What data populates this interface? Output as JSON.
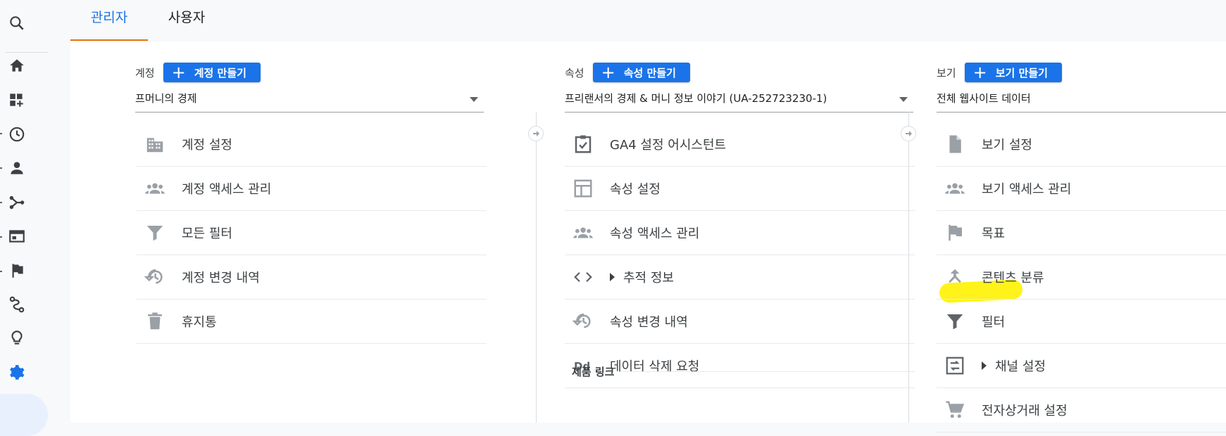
{
  "tabs": [
    {
      "label": "관리자",
      "active": true
    },
    {
      "label": "사용자",
      "active": false
    }
  ],
  "rail": {
    "icons": [
      "search-icon",
      "home-icon",
      "dashboard-add-icon",
      "clock-icon",
      "person-icon",
      "share-icon",
      "view-icon",
      "flag-icon",
      "route-icon",
      "lightbulb-icon",
      "gear-icon"
    ]
  },
  "account": {
    "label": "계정",
    "create_button": "계정 만들기",
    "selected": "프머니의 경제",
    "items": [
      {
        "label": "계정 설정",
        "icon": "building-icon"
      },
      {
        "label": "계정 액세스 관리",
        "icon": "people-icon"
      },
      {
        "label": "모든 필터",
        "icon": "filter-icon"
      },
      {
        "label": "계정 변경 내역",
        "icon": "history-icon"
      },
      {
        "label": "휴지통",
        "icon": "trash-icon"
      }
    ]
  },
  "property": {
    "label": "속성",
    "create_button": "속성 만들기",
    "selected": "프리랜서의 경제 & 머니 정보 이야기 (UA-252723230-1)",
    "items": [
      {
        "label": "GA4 설정 어시스턴트",
        "icon": "checklist-icon"
      },
      {
        "label": "속성 설정",
        "icon": "layout-icon"
      },
      {
        "label": "속성 액세스 관리",
        "icon": "people-icon"
      },
      {
        "label": "추적 정보",
        "icon": "code-icon",
        "expandable": true
      },
      {
        "label": "속성 변경 내역",
        "icon": "history-icon"
      },
      {
        "label": "데이터 삭제 요청",
        "icon": "dd-icon"
      }
    ],
    "section": "제품 링크"
  },
  "view": {
    "label": "보기",
    "create_button": "보기 만들기",
    "selected": "전체 웹사이트 데이터",
    "items": [
      {
        "label": "보기 설정",
        "icon": "document-icon"
      },
      {
        "label": "보기 액세스 관리",
        "icon": "people-icon"
      },
      {
        "label": "목표",
        "icon": "flag-icon"
      },
      {
        "label": "콘텐츠 분류",
        "icon": "merge-icon"
      },
      {
        "label": "필터",
        "icon": "filter-icon",
        "highlighted": true
      },
      {
        "label": "채널 설정",
        "icon": "channel-icon",
        "expandable": true
      },
      {
        "label": "전자상거래 설정",
        "icon": "cart-icon"
      }
    ]
  },
  "colors": {
    "accent": "#1a73e8",
    "tab_underline": "#e8710a",
    "highlight": "#fff200",
    "icon_gray": "#5f6368"
  }
}
